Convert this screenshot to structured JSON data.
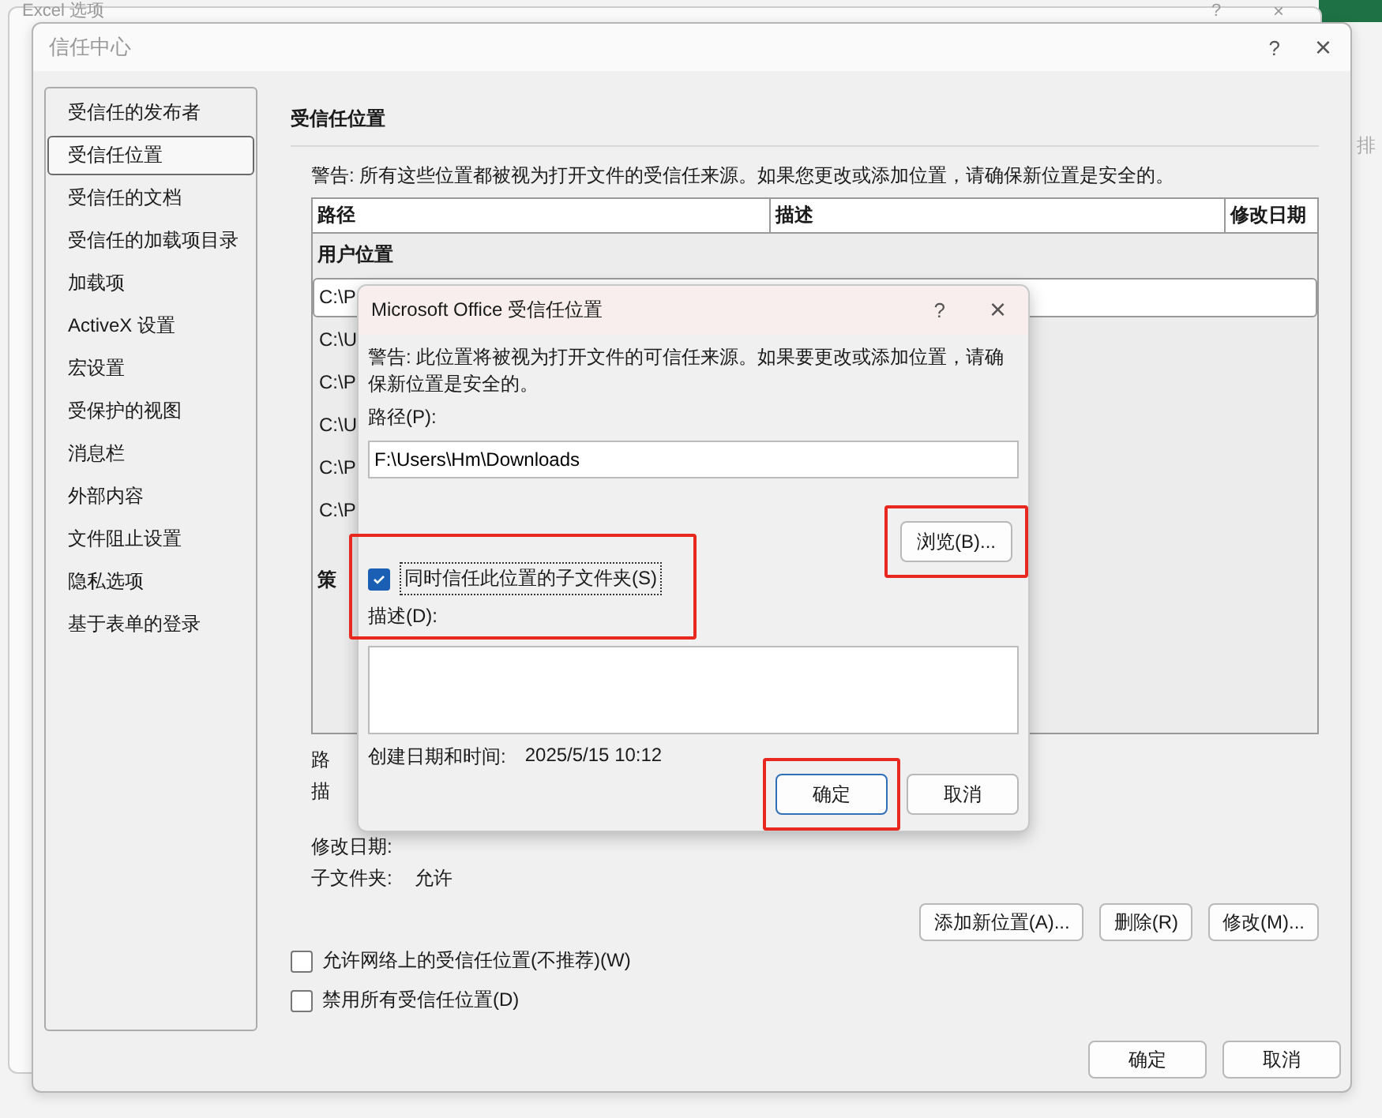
{
  "background_window": {
    "title": "Excel 选项",
    "help": "?",
    "close": "×",
    "side_text": "排"
  },
  "window": {
    "title": "信任中心",
    "help": "?",
    "close": "×"
  },
  "sidebar": {
    "items": [
      {
        "label": "受信任的发布者",
        "selected": false
      },
      {
        "label": "受信任位置",
        "selected": true
      },
      {
        "label": "受信任的文档",
        "selected": false
      },
      {
        "label": "受信任的加载项目录",
        "selected": false
      },
      {
        "label": "加载项",
        "selected": false
      },
      {
        "label": "ActiveX 设置",
        "selected": false
      },
      {
        "label": "宏设置",
        "selected": false
      },
      {
        "label": "受保护的视图",
        "selected": false
      },
      {
        "label": "消息栏",
        "selected": false
      },
      {
        "label": "外部内容",
        "selected": false
      },
      {
        "label": "文件阻止设置",
        "selected": false
      },
      {
        "label": "隐私选项",
        "selected": false
      },
      {
        "label": "基于表单的登录",
        "selected": false
      }
    ]
  },
  "section_title": "受信任位置",
  "warning": "警告: 所有这些位置都被视为打开文件的受信任来源。如果您更改或添加位置，请确保新位置是安全的。",
  "table": {
    "columns": [
      "路径",
      "描述",
      "修改日期"
    ],
    "group": "用户位置",
    "rows": [
      {
        "path": "C:\\P",
        "selected": true
      },
      {
        "path": "C:\\U",
        "selected": false
      },
      {
        "path": "C:\\P",
        "selected": false
      },
      {
        "path": "C:\\U",
        "selected": false
      },
      {
        "path": "C:\\P",
        "selected": false
      },
      {
        "path": "C:\\P",
        "selected": false
      }
    ],
    "policy_group": "策"
  },
  "details": [
    {
      "label": "路"
    },
    {
      "label": "描"
    },
    {
      "label": "修改日期:"
    },
    {
      "label": "子文件夹:",
      "value": "允许"
    }
  ],
  "location_buttons": [
    "添加新位置(A)...",
    "删除(R)",
    "修改(M)..."
  ],
  "options": [
    {
      "label": "允许网络上的受信任位置(不推荐)(W)",
      "checked": false
    },
    {
      "label": "禁用所有受信任位置(D)",
      "checked": false
    }
  ],
  "buttons": [
    "确定",
    "取消"
  ],
  "dialog": {
    "title": "Microsoft Office 受信任位置",
    "help": "?",
    "close": "×",
    "warning": "警告: 此位置将被视为打开文件的可信任来源。如果要更改或添加位置，请确保新位置是安全的。",
    "path_label": "路径(P):",
    "path_value": "F:\\Users\\Hm\\Downloads",
    "browse": {
      "label": "浏览(B)...",
      "highlighted": true
    },
    "subfolders": {
      "label": "同时信任此位置的子文件夹(S)",
      "checked": true,
      "highlighted": true
    },
    "description_label": "描述(D):",
    "created": {
      "label": "创建日期和时间:",
      "value": "2025/5/15 10:12"
    },
    "ok": {
      "label": "确定",
      "highlighted": true
    },
    "cancel": "取消"
  }
}
